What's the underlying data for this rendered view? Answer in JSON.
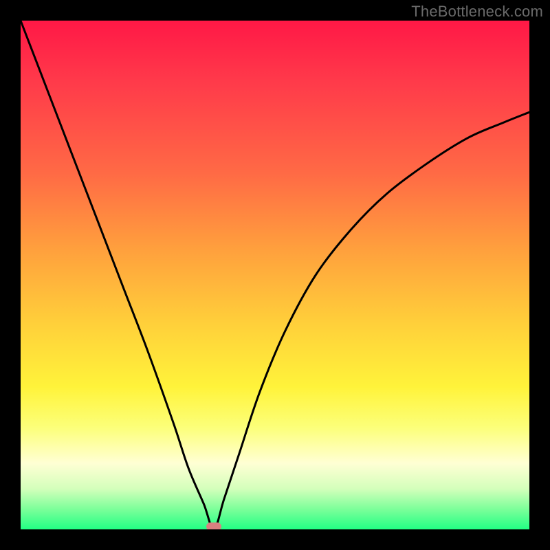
{
  "watermark": "TheBottleneck.com",
  "chart_data": {
    "type": "line",
    "title": "",
    "xlabel": "",
    "ylabel": "",
    "xlim": [
      0,
      100
    ],
    "ylim": [
      0,
      100
    ],
    "grid": false,
    "legend": false,
    "annotations": [],
    "minimum_marker": {
      "x": 38,
      "y": 0
    },
    "series": [
      {
        "name": "curve",
        "x": [
          0,
          5,
          10,
          15,
          20,
          25,
          30,
          33,
          36,
          38,
          40,
          43,
          47,
          52,
          58,
          65,
          72,
          80,
          88,
          95,
          100
        ],
        "y": [
          100,
          87,
          74,
          61,
          48,
          35,
          21,
          12,
          5,
          0,
          6,
          15,
          27,
          39,
          50,
          59,
          66,
          72,
          77,
          80,
          82
        ]
      }
    ],
    "colors": {
      "curve": "#000000",
      "marker": "#d98080",
      "background_top": "#ff1846",
      "background_bottom": "#22ff84"
    }
  }
}
